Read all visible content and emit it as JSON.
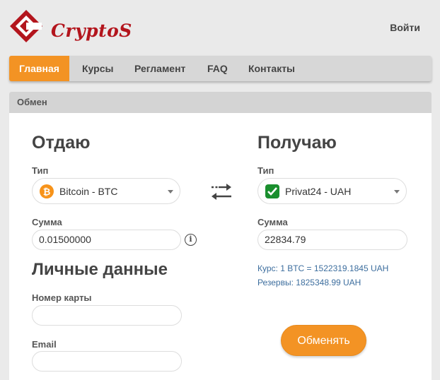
{
  "header": {
    "logo_text": "CryptoS",
    "login_label": "Войти"
  },
  "nav": {
    "items": [
      {
        "label": "Главная",
        "active": true
      },
      {
        "label": "Курсы"
      },
      {
        "label": "Регламент"
      },
      {
        "label": "FAQ"
      },
      {
        "label": "Контакты"
      }
    ]
  },
  "panel": {
    "title": "Обмен"
  },
  "give": {
    "heading": "Отдаю",
    "type_label": "Тип",
    "currency": "Bitcoin - BTC",
    "currency_icon": "bitcoin-icon",
    "amount_label": "Сумма",
    "amount": "0.01500000"
  },
  "get": {
    "heading": "Получаю",
    "type_label": "Тип",
    "currency": "Privat24 - UAH",
    "currency_icon": "privat24-icon",
    "amount_label": "Сумма",
    "amount": "22834.79",
    "rate_text": "Курс: 1 BTC = 1522319.1845 UAH",
    "reserve_text": "Резервы: 1825348.99 UAH"
  },
  "personal": {
    "heading": "Личные данные",
    "card_label": "Номер карты",
    "card_value": "",
    "email_label": "Email",
    "email_value": ""
  },
  "actions": {
    "exchange_label": "Обменять"
  },
  "colors": {
    "accent": "#f39324",
    "brand": "#b3151d",
    "rate_text": "#3d6e9e"
  }
}
